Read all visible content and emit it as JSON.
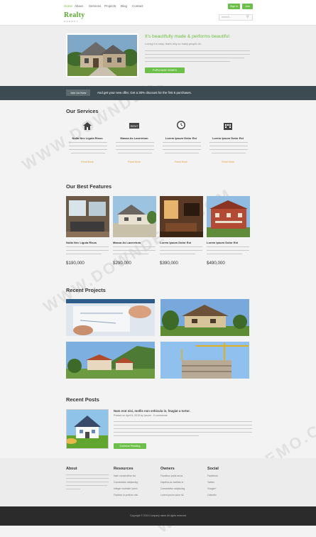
{
  "nav": [
    "Home",
    "About",
    "Services",
    "Projects",
    "Blog",
    "Contact"
  ],
  "logo": {
    "name": "Realty",
    "tag": "AGENCY"
  },
  "header": {
    "signin": "Sign in",
    "join": "Join",
    "search_placeholder": "search..."
  },
  "hero": {
    "title": "It's beautifully made & performs beautiful",
    "subtitle": "Loving it is easy. that's why so many people do.",
    "button": "PURCHASE HOMES"
  },
  "banner": {
    "button": "Join Us Now",
    "text": "And get your new offer, Get a 30% discount for the first 5 purchases."
  },
  "services": {
    "heading": "Our Services",
    "items": [
      {
        "title": "Nulla Nec Ligula Risus",
        "more": "Read More",
        "icon": "house-icon"
      },
      {
        "title": "Massa As Laorretum",
        "more": "Read More",
        "icon": "rent-sign-icon"
      },
      {
        "title": "Lorem Ipsum Dolor Est",
        "more": "Read More",
        "icon": "clock-icon"
      },
      {
        "title": "Lorem Ipsum Dolor Est",
        "more": "Read More",
        "icon": "building-icon"
      }
    ]
  },
  "features": {
    "heading": "Our Best Features",
    "items": [
      {
        "title": "Nulla Nec Ligula Risus",
        "price": "$190,000"
      },
      {
        "title": "Massa As Laorretum",
        "price": "$290,000"
      },
      {
        "title": "Lorem Ipsum Dolor Est",
        "price": "$390,000"
      },
      {
        "title": "Lorem Ipsum Dolor Est",
        "price": "$490,000"
      }
    ]
  },
  "projects": {
    "heading": "Recent Projects"
  },
  "posts": {
    "heading": "Recent Posts",
    "title": "Nam erat nisi, mollis non vehicula in, feugiat a tortor.",
    "meta": "Posted on April 8, 2015 by Ipsum - 0 comments",
    "button": "Continue Reading"
  },
  "footer": {
    "columns": [
      {
        "heading": "About",
        "links": []
      },
      {
        "heading": "Resources",
        "links": [
          "Nam consectetur dui",
          "Consectetur adipiscing",
          "Integer molestie lorem",
          "Facilisis in pretium nisl"
        ]
      },
      {
        "heading": "Owners",
        "links": [
          "Faucibus porta lacus",
          "Dapibus ac facilisis in",
          "Consectetur adipiscing",
          "Lorem ipsum dolor sit"
        ]
      },
      {
        "heading": "Social",
        "links": [
          "Facebook",
          "Twitter",
          "Google+",
          "Linkedin"
        ]
      }
    ],
    "copyright": "Copyright © 2015 Company name All rights reserved"
  },
  "colors": {
    "accent": "#6cc04a",
    "banner": "#3c4b52",
    "footer_bottom": "#2b2b2b"
  },
  "watermark": "WWW.DOWNDEMO.COM"
}
